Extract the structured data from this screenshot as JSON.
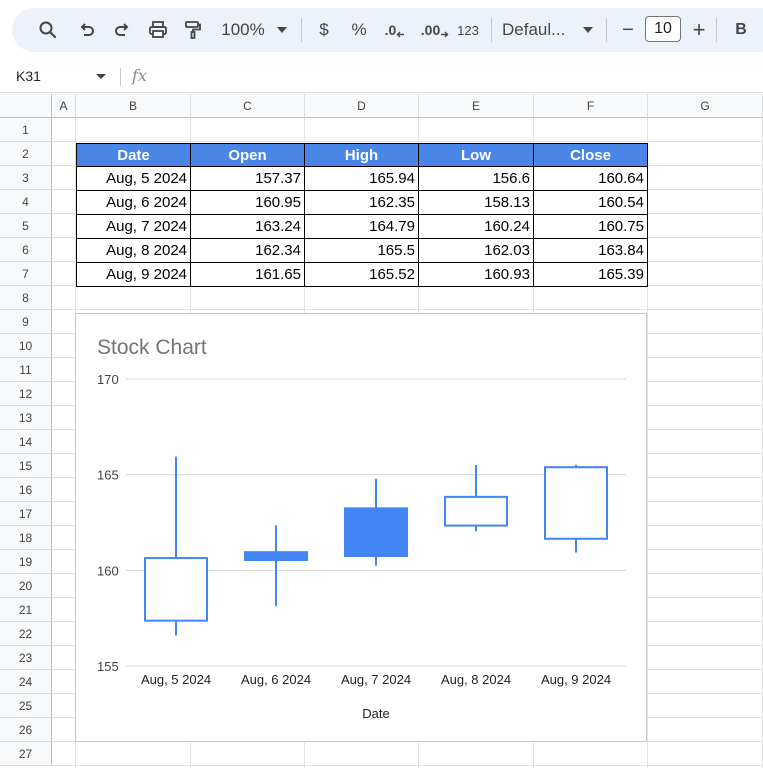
{
  "toolbar": {
    "zoom": "100%",
    "currency": "$",
    "percent": "%",
    "dec_decrease": ".0",
    "dec_increase": ".00",
    "number_format": "123",
    "font": "Defaul...",
    "font_size": "10",
    "minus": "−",
    "plus": "+",
    "bold": "B"
  },
  "formula_bar": {
    "name_box": "K31",
    "fx": "fx"
  },
  "columns": [
    "A",
    "B",
    "C",
    "D",
    "E",
    "F",
    "G"
  ],
  "rows": [
    "1",
    "2",
    "3",
    "4",
    "5",
    "6",
    "7",
    "8",
    "9",
    "10",
    "11",
    "12",
    "13",
    "14",
    "15",
    "16",
    "17",
    "18",
    "19",
    "20",
    "21",
    "22",
    "23",
    "24",
    "25",
    "26",
    "27"
  ],
  "table": {
    "headers": [
      "Date",
      "Open",
      "High",
      "Low",
      "Close"
    ],
    "rows": [
      [
        "Aug, 5 2024",
        "157.37",
        "165.94",
        "156.6",
        "160.64"
      ],
      [
        "Aug, 6 2024",
        "160.95",
        "162.35",
        "158.13",
        "160.54"
      ],
      [
        "Aug, 7 2024",
        "163.24",
        "164.79",
        "160.24",
        "160.75"
      ],
      [
        "Aug, 8 2024",
        "162.34",
        "165.5",
        "162.03",
        "163.84"
      ],
      [
        "Aug, 9 2024",
        "161.65",
        "165.52",
        "160.93",
        "165.39"
      ]
    ]
  },
  "colors": {
    "header_bg": "#4a86e8",
    "series": "#4285f4"
  },
  "chart_data": {
    "type": "candlestick",
    "title": "Stock Chart",
    "xlabel": "Date",
    "ylabel": "",
    "ylim": [
      155,
      170
    ],
    "yticks": [
      "155",
      "160",
      "165",
      "170"
    ],
    "categories": [
      "Aug, 5 2024",
      "Aug, 6 2024",
      "Aug, 7 2024",
      "Aug, 8 2024",
      "Aug, 9 2024"
    ],
    "open": [
      157.37,
      160.95,
      163.24,
      162.34,
      161.65
    ],
    "high": [
      165.94,
      162.35,
      164.79,
      165.5,
      165.52
    ],
    "low": [
      156.6,
      158.13,
      160.24,
      162.03,
      160.93
    ],
    "close": [
      160.64,
      160.54,
      160.75,
      163.84,
      165.39
    ],
    "grid": true,
    "legend": "none"
  }
}
